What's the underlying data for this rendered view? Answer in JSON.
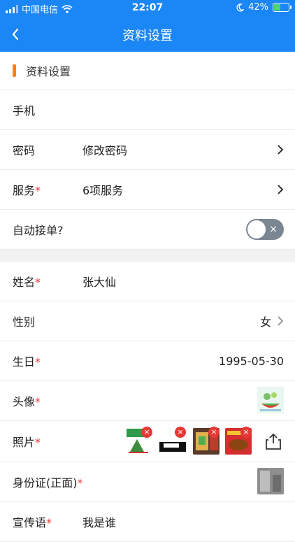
{
  "status_bar": {
    "carrier": "中国电信",
    "time": "22:07",
    "battery": "42%",
    "battery_level": 0.42,
    "icons": [
      "signal-icon",
      "wifi-icon",
      "moon-icon",
      "battery-icon"
    ]
  },
  "navbar": {
    "title": "资料设置",
    "back_icon": "chevron-left-icon"
  },
  "section": {
    "title": "资料设置",
    "accent": "#f5821f"
  },
  "rows": {
    "phone": {
      "label": "手机"
    },
    "password": {
      "label": "密码",
      "value": "修改密码"
    },
    "service": {
      "label": "服务",
      "req": "*",
      "value": "6项服务"
    },
    "auto_accept": {
      "label": "自动接单?",
      "toggle_symbol": "×",
      "toggle_on": false
    },
    "name": {
      "label": "姓名",
      "req": "*",
      "value": "张大仙"
    },
    "gender": {
      "label": "性别",
      "value": "女"
    },
    "birthday": {
      "label": "生日",
      "req": "*",
      "value": "1995-05-30"
    },
    "avatar": {
      "label": "头像",
      "req": "*"
    },
    "photos": {
      "label": "照片",
      "req": "*",
      "delete_symbol": "×",
      "count": 4
    },
    "idcard": {
      "label": "身份证(正面)",
      "req": "*"
    },
    "slogan": {
      "label": "宣传语",
      "req": "*",
      "value": "我是谁"
    }
  },
  "colors": {
    "primary": "#1b86f5",
    "required": "#e53935",
    "toggle_off": "#7a8691"
  }
}
